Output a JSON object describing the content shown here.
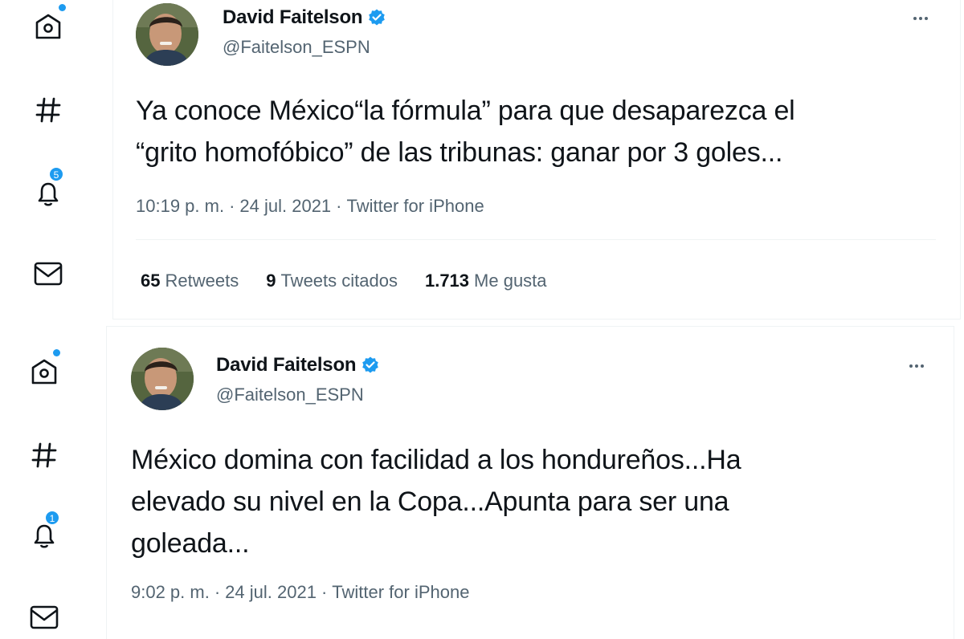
{
  "colors": {
    "accent": "#1d9bf0",
    "text": "#0f1419",
    "secondary": "#536471",
    "divider": "#eff3f4"
  },
  "panels": [
    {
      "sidebar": {
        "icons": [
          "home-icon",
          "explore-hashtag-icon",
          "notifications-bell-icon",
          "messages-envelope-icon"
        ],
        "notification_count": "5"
      },
      "tweet": {
        "display_name": "David Faitelson",
        "handle": "@Faitelson_ESPN",
        "text_lines": [
          "Ya conoce México“la fórmula” para que desaparezca el",
          "“grito homofóbico” de las tribunas: ganar por 3 goles..."
        ],
        "time": "10:19 p. m.",
        "date": "24 jul. 2021",
        "source": "Twitter for iPhone",
        "stats": [
          {
            "count": "65",
            "label": "Retweets"
          },
          {
            "count": "9",
            "label": "Tweets citados"
          },
          {
            "count": "1.713",
            "label": "Me gusta"
          }
        ]
      }
    },
    {
      "sidebar": {
        "icons": [
          "home-icon",
          "explore-hashtag-icon",
          "notifications-bell-icon",
          "messages-envelope-icon"
        ],
        "notification_count": "1"
      },
      "tweet": {
        "display_name": "David Faitelson",
        "handle": "@Faitelson_ESPN",
        "text_lines": [
          "México domina con facilidad a los hondureños...Ha",
          "elevado su nivel en la Copa...Apunta para ser una",
          "goleada..."
        ],
        "time": "9:02 p. m.",
        "date": "24 jul. 2021",
        "source": "Twitter for iPhone"
      }
    }
  ]
}
